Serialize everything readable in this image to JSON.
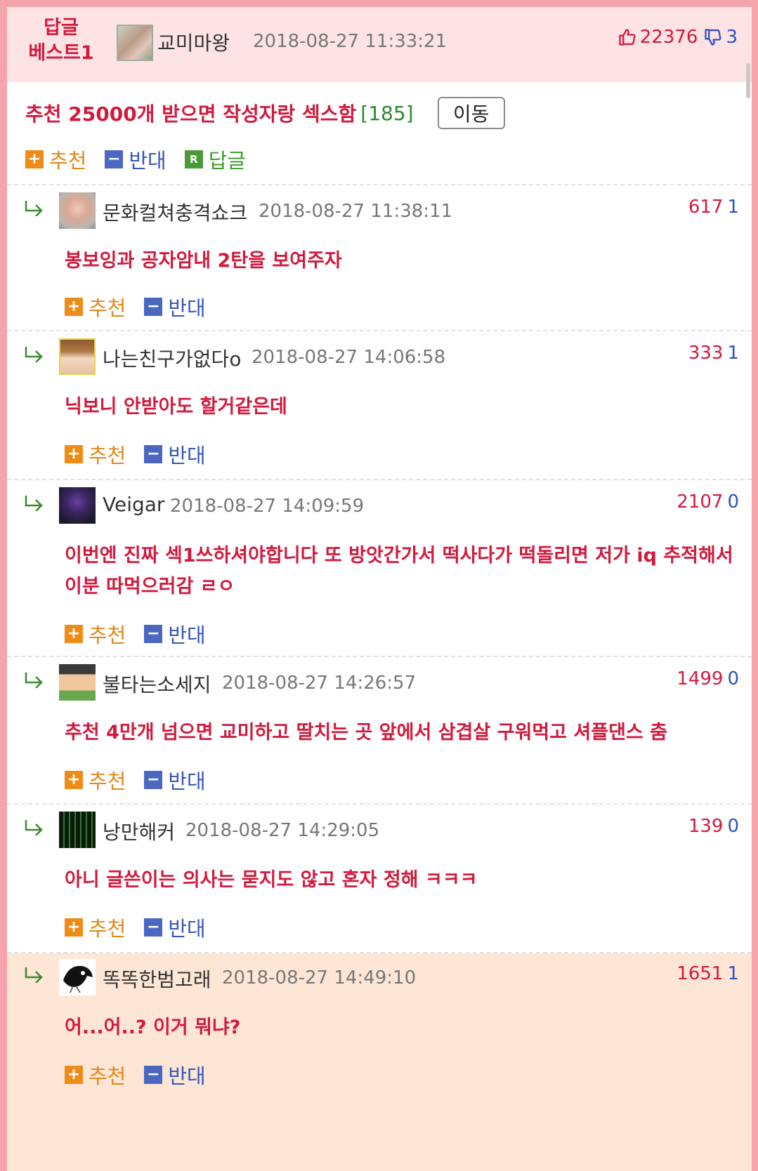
{
  "header": {
    "best_line1": "답글",
    "best_line2": "베스트1",
    "nickname": "교미마왕",
    "date": "2018-08-27 11:33:21",
    "up_count": "22376",
    "down_count": "3"
  },
  "post": {
    "title": "추천 25000개 받으면 작성자랑 섹스함",
    "count": "[185]",
    "move_button": "이동",
    "recommend_label": "추천",
    "oppose_label": "반대",
    "reply_label": "답글"
  },
  "comments": [
    {
      "nickname": "문화컬쳐충격쇼크",
      "date": "2018-08-27 11:38:11",
      "up": "617",
      "down": "1",
      "text": "봉보잉과 공자암내 2탄을 보여주자"
    },
    {
      "nickname": "나는친구가없다o",
      "date": "2018-08-27 14:06:58",
      "up": "333",
      "down": "1",
      "text": "닉보니 안받아도 할거같은데"
    },
    {
      "nickname": "Veigar",
      "date": "2018-08-27 14:09:59",
      "up": "2107",
      "down": "0",
      "text": "이번엔 진짜 섹1쓰하셔야합니다 또 방앗간가서 떡사다가 떡돌리면 저가 iq 추적해서 이분 따먹으러감 ㄹㅇ"
    },
    {
      "nickname": "불타는소세지",
      "date": "2018-08-27 14:26:57",
      "up": "1499",
      "down": "0",
      "text": "추천 4만개 넘으면 교미하고 딸치는 곳 앞에서 삼겹살 구워먹고 셔플댄스 춤"
    },
    {
      "nickname": "낭만해커",
      "date": "2018-08-27 14:29:05",
      "up": "139",
      "down": "0",
      "text": "아니 글쓴이는 의사는 묻지도 않고 혼자 정해 ㅋㅋㅋ"
    },
    {
      "nickname": "똑똑한범고래",
      "date": "2018-08-27 14:49:10",
      "up": "1651",
      "down": "1",
      "text": "어...어..? 이거 뭐냐?"
    }
  ],
  "colors": {
    "accent_red": "#d21a3d",
    "accent_blue": "#2f51c6",
    "recommend_orange": "#ef8b17",
    "reply_green": "#4b9a3a",
    "highlight_bg": "#fde6d6",
    "header_bg": "#fde3e4"
  },
  "icons": {
    "thumbs_up": "thumbs-up-icon",
    "thumbs_down": "thumbs-down-icon",
    "reply_arrow": "reply-arrow-icon",
    "plus": "plus-icon",
    "minus": "minus-icon",
    "reply_r": "reply-r-icon"
  }
}
